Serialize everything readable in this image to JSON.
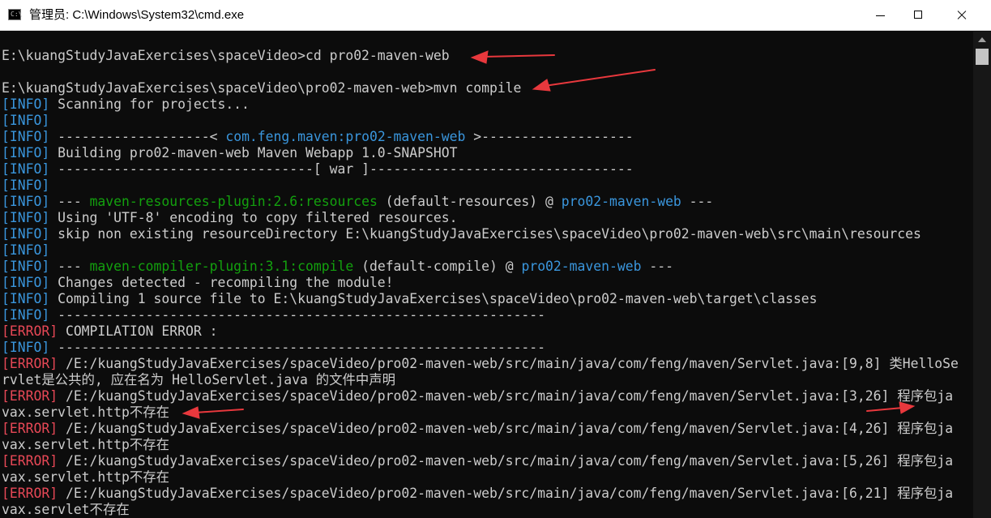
{
  "window": {
    "icon_label": "C:\\",
    "title": "管理员: C:\\Windows\\System32\\cmd.exe",
    "controls": [
      "minimize-icon",
      "maximize-icon",
      "close-icon"
    ]
  },
  "colors": {
    "background": "#0c0c0c",
    "text": "#cccccc",
    "info_tag": "#3a96dd",
    "error_tag": "#e74856",
    "plugin_name": "#13a10e",
    "annotation_arrow": "#e8383d"
  },
  "console": {
    "cmd1": "E:\\kuangStudyJavaExercises\\spaceVideo>cd pro02-maven-web",
    "cmd2": "E:\\kuangStudyJavaExercises\\spaceVideo\\pro02-maven-web>mvn compile",
    "tag_info": "[INFO]",
    "tag_error": "[ERROR]",
    "l03": " Scanning for projects...",
    "l05a": " -------------------< ",
    "l05b": "com.feng.maven:pro02-maven-web",
    "l05c": " >-------------------",
    "l06": " Building pro02-maven-web Maven Webapp 1.0-SNAPSHOT",
    "l07": " --------------------------------[ war ]---------------------------------",
    "l09a": " --- ",
    "l09b": "maven-resources-plugin:2.6:resources",
    "l09c": " (default-resources) @ ",
    "l09d": "pro02-maven-web",
    "l09e": " ---",
    "l10": " Using 'UTF-8' encoding to copy filtered resources.",
    "l11": " skip non existing resourceDirectory E:\\kuangStudyJavaExercises\\spaceVideo\\pro02-maven-web\\src\\main\\resources",
    "l13a": " --- ",
    "l13b": "maven-compiler-plugin:3.1:compile",
    "l13c": " (default-compile) @ ",
    "l13d": "pro02-maven-web",
    "l13e": " ---",
    "l14": " Changes detected - recompiling the module!",
    "l15": " Compiling 1 source file to E:\\kuangStudyJavaExercises\\spaceVideo\\pro02-maven-web\\target\\classes",
    "l16": " -------------------------------------------------------------",
    "l17": " COMPILATION ERROR :",
    "l18": " -------------------------------------------------------------",
    "l19": " /E:/kuangStudyJavaExercises/spaceVideo/pro02-maven-web/src/main/java/com/feng/maven/Servlet.java:[9,8] 类HelloSe",
    "l20": "rvlet是公共的, 应在名为 HelloServlet.java 的文件中声明",
    "l21": " /E:/kuangStudyJavaExercises/spaceVideo/pro02-maven-web/src/main/java/com/feng/maven/Servlet.java:[3,26] 程序包ja",
    "l22": "vax.servlet.http不存在",
    "l23": " /E:/kuangStudyJavaExercises/spaceVideo/pro02-maven-web/src/main/java/com/feng/maven/Servlet.java:[4,26] 程序包ja",
    "l24": "vax.servlet.http不存在",
    "l25": " /E:/kuangStudyJavaExercises/spaceVideo/pro02-maven-web/src/main/java/com/feng/maven/Servlet.java:[5,26] 程序包ja",
    "l26": "vax.servlet.http不存在",
    "l27": " /E:/kuangStudyJavaExercises/spaceVideo/pro02-maven-web/src/main/java/com/feng/maven/Servlet.java:[6,21] 程序包ja",
    "l28": "vax.servlet不存在"
  }
}
